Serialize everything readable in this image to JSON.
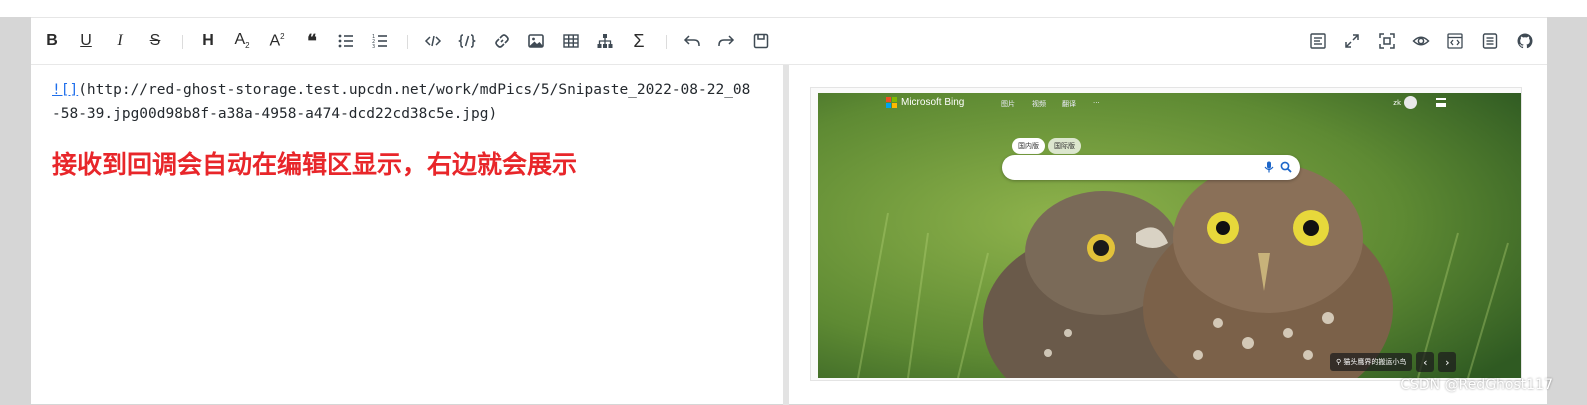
{
  "toolbar": {
    "bold": "B",
    "underline": "U",
    "italic": "I",
    "strikethrough": "S",
    "heading": "H",
    "subscript": "A",
    "subscript_mark": "2",
    "superscript": "A",
    "superscript_mark": "2",
    "quote": "❝",
    "sum": "Σ"
  },
  "source": {
    "image_markdown_prefix": "![]",
    "image_markdown_url": "(http://red-ghost-storage.test.upcdn.net/work/mdPics/5/Snipaste_2022-08-22_08-58-39.jpg00d98b8f-a38a-4958-a474-dcd22cd38c5e.jpg)",
    "heading_text": "接收到回调会自动在编辑区显示，右边就会展示"
  },
  "preview": {
    "bing": {
      "logo_text": "Microsoft Bing",
      "nav_links": [
        "图片",
        "视频",
        "翻译",
        "···"
      ],
      "tabs": [
        "国内版",
        "国际版"
      ],
      "user": "zk",
      "caption": "猫头鹰界的搬运小鸟"
    }
  },
  "watermark": "CSDN @RedGhost117",
  "colors": {
    "heading": "#e8262a",
    "link_underline": "#1f6feb"
  }
}
